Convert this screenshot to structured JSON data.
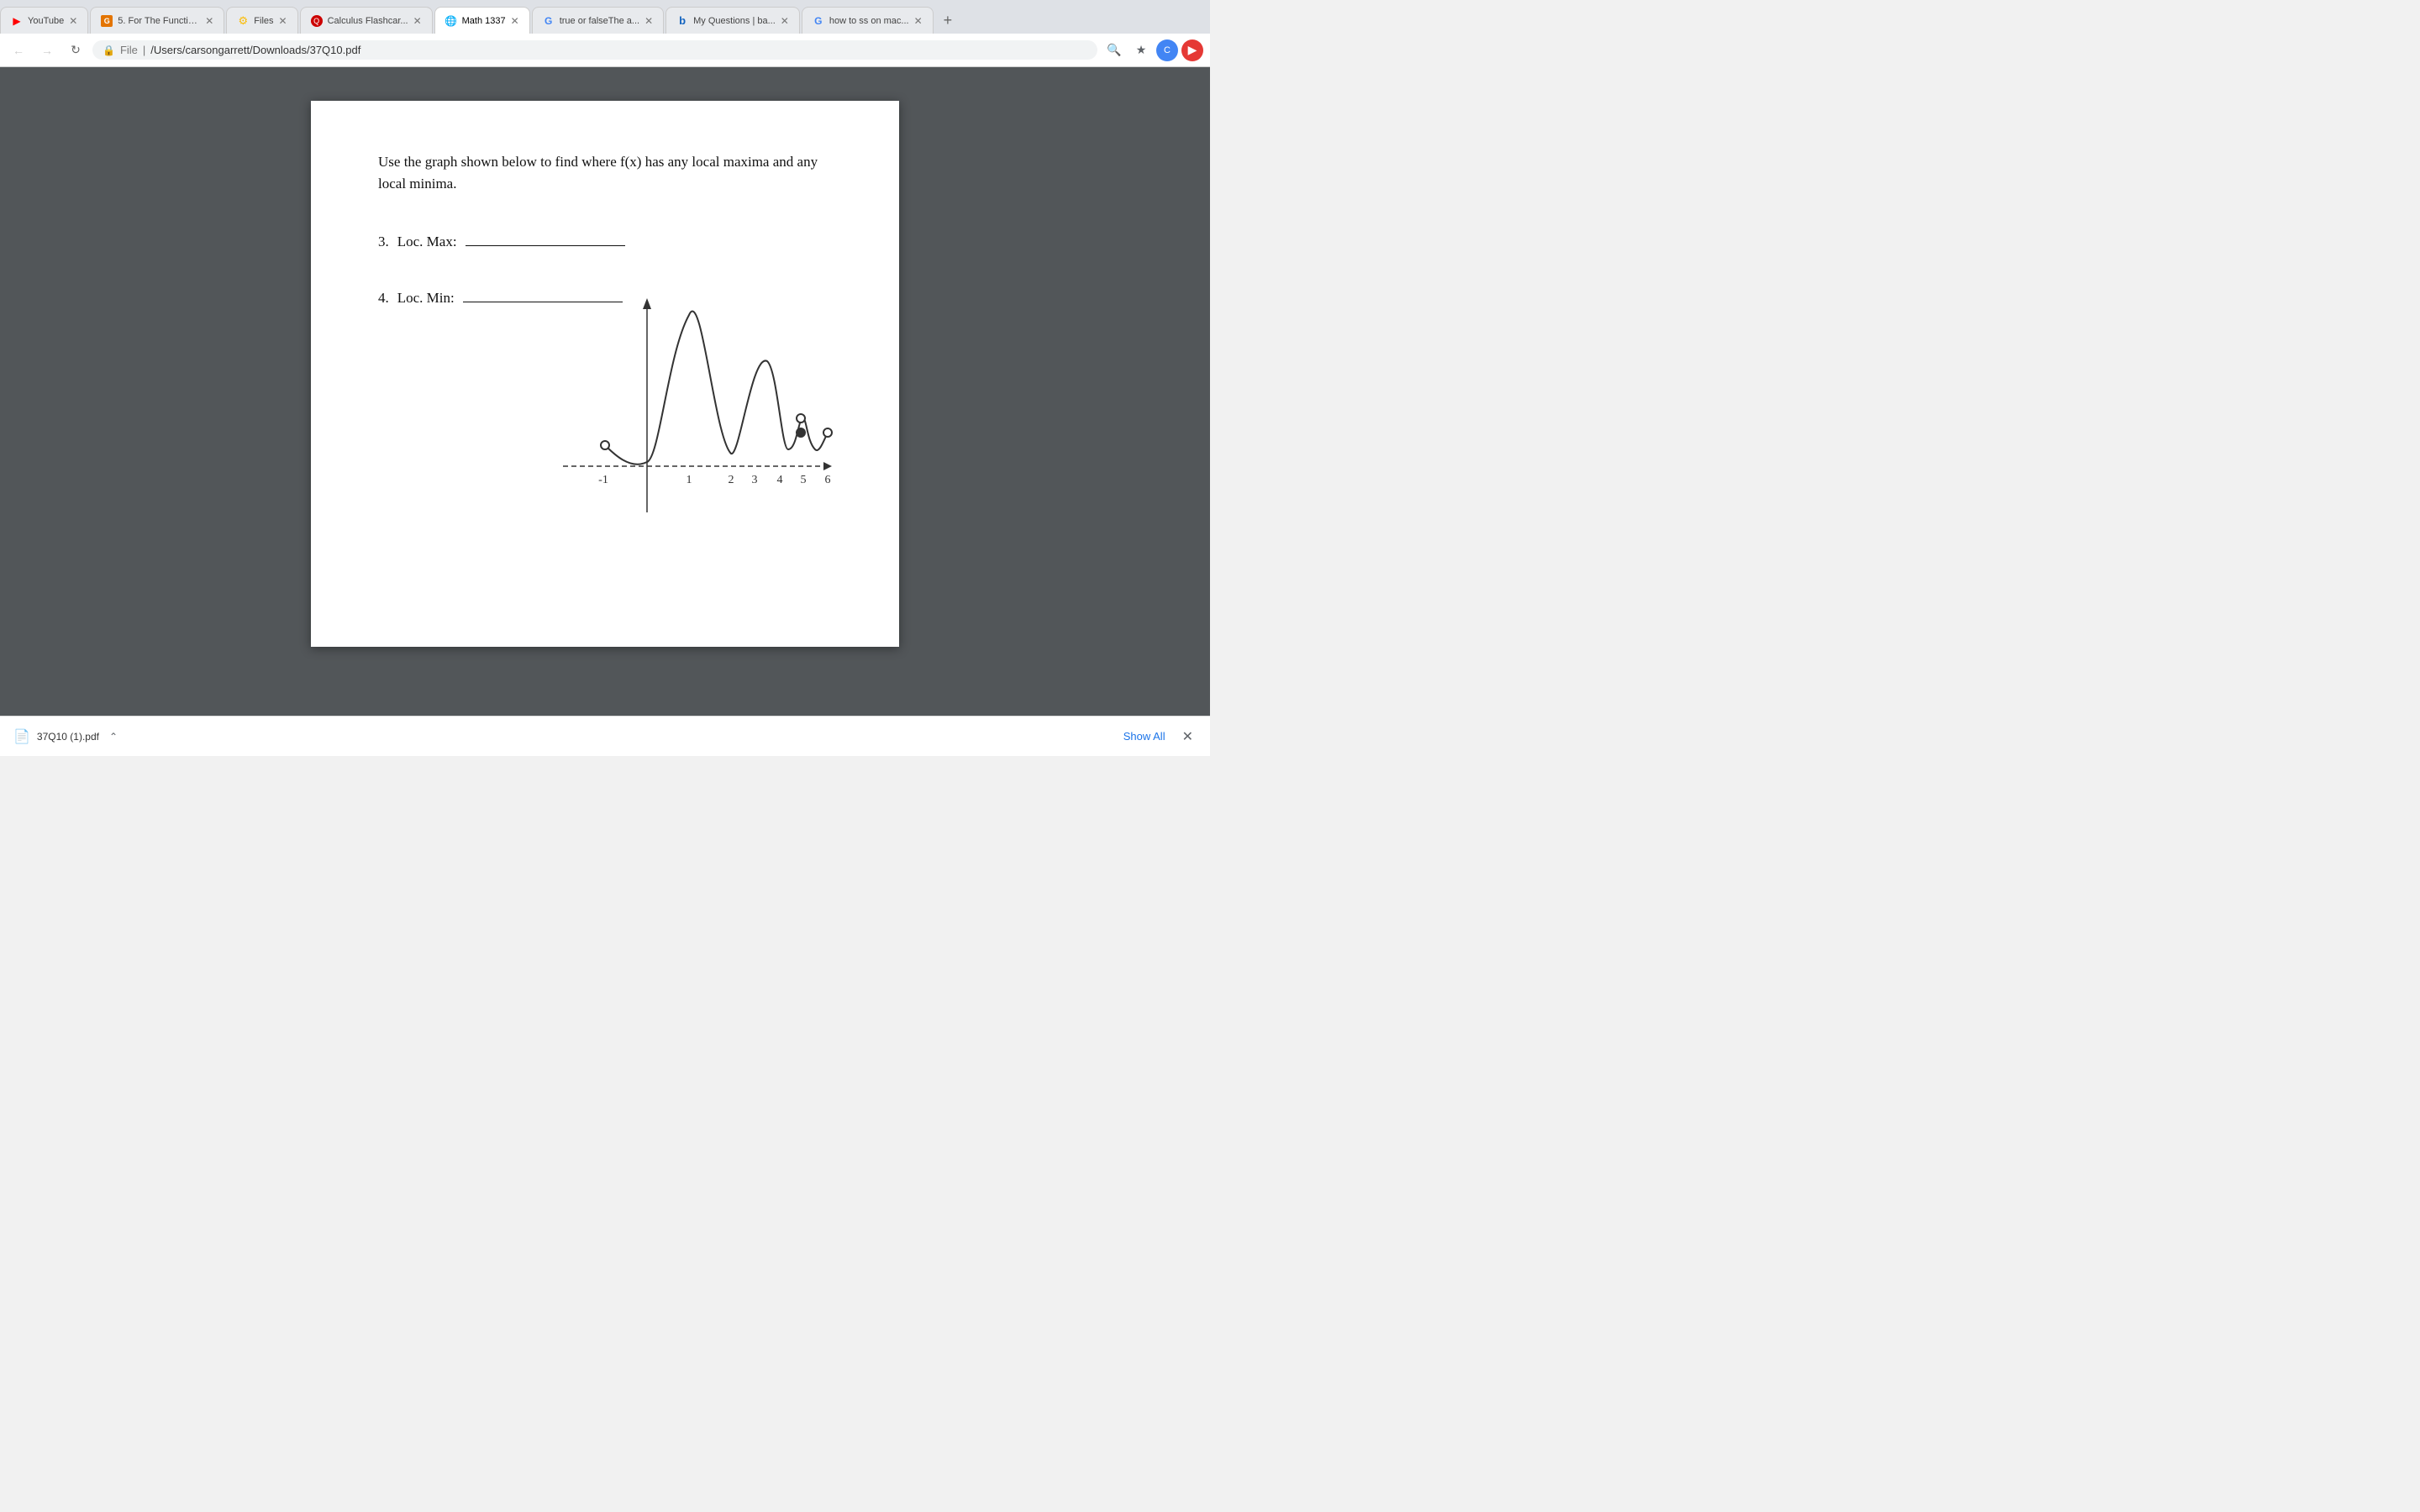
{
  "browser": {
    "tabs": [
      {
        "id": "tab-youtube",
        "title": "YouTube",
        "favicon_type": "yt",
        "favicon_label": "▶",
        "active": false,
        "closeable": true
      },
      {
        "id": "tab-function",
        "title": "5. For The Functio...",
        "favicon_type": "g",
        "favicon_label": "G",
        "active": false,
        "closeable": true
      },
      {
        "id": "tab-files",
        "title": "Files",
        "favicon_type": "files",
        "favicon_label": "⚙",
        "active": false,
        "closeable": true
      },
      {
        "id": "tab-calculus",
        "title": "Calculus Flashcar...",
        "favicon_type": "q",
        "favicon_label": "Q",
        "active": false,
        "closeable": true
      },
      {
        "id": "tab-math",
        "title": "Math 1337",
        "favicon_type": "globe",
        "favicon_label": "🌐",
        "active": true,
        "closeable": true
      },
      {
        "id": "tab-truefalse",
        "title": "true or falseThe a...",
        "favicon_type": "g",
        "favicon_label": "G",
        "active": false,
        "closeable": true
      },
      {
        "id": "tab-myquestions",
        "title": "My Questions | ba...",
        "favicon_type": "b",
        "favicon_label": "b",
        "active": false,
        "closeable": true
      },
      {
        "id": "tab-howto",
        "title": "how to ss on mac...",
        "favicon_type": "g",
        "favicon_label": "G",
        "active": false,
        "closeable": true
      }
    ],
    "address_bar": {
      "url_display": "/Users/carsongarrett/Downloads/37Q10.pdf",
      "file_prefix": "File",
      "lock_icon": "🔒"
    }
  },
  "pdf": {
    "problem_text": "Use the graph shown below to find where f(x) has any local maxima and any local minima.",
    "questions": [
      {
        "number": "3.",
        "label": "Loc. Max:",
        "answer": ""
      },
      {
        "number": "4.",
        "label": "Loc. Min:",
        "answer": ""
      }
    ],
    "graph": {
      "x_labels": [
        "-1",
        "1",
        "2",
        "3",
        "4",
        "5",
        "6"
      ],
      "title": ""
    }
  },
  "download_bar": {
    "filename": "37Q10 (1).pdf",
    "show_all_label": "Show All",
    "file_icon": "📄"
  }
}
